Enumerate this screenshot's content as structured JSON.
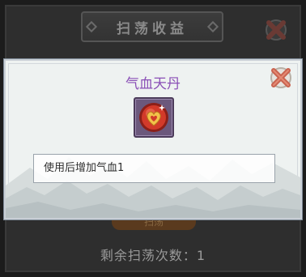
{
  "background_panel": {
    "title": "扫荡收益",
    "bottom_button_label": "扫荡",
    "remaining_sweeps": "剩余扫荡次数：1"
  },
  "popup": {
    "item_name": "气血天丹",
    "item_icon": "qixue-tiandan-pill-icon",
    "description": "使用后增加气血1",
    "colors": {
      "item_name": "#8a4fb6",
      "icon_frame": "#6b587c",
      "icon_orb": "#d23a2a",
      "icon_heart": "#f2c24a"
    }
  },
  "icons": [
    "close-icon",
    "qixue-tiandan-pill-icon"
  ]
}
